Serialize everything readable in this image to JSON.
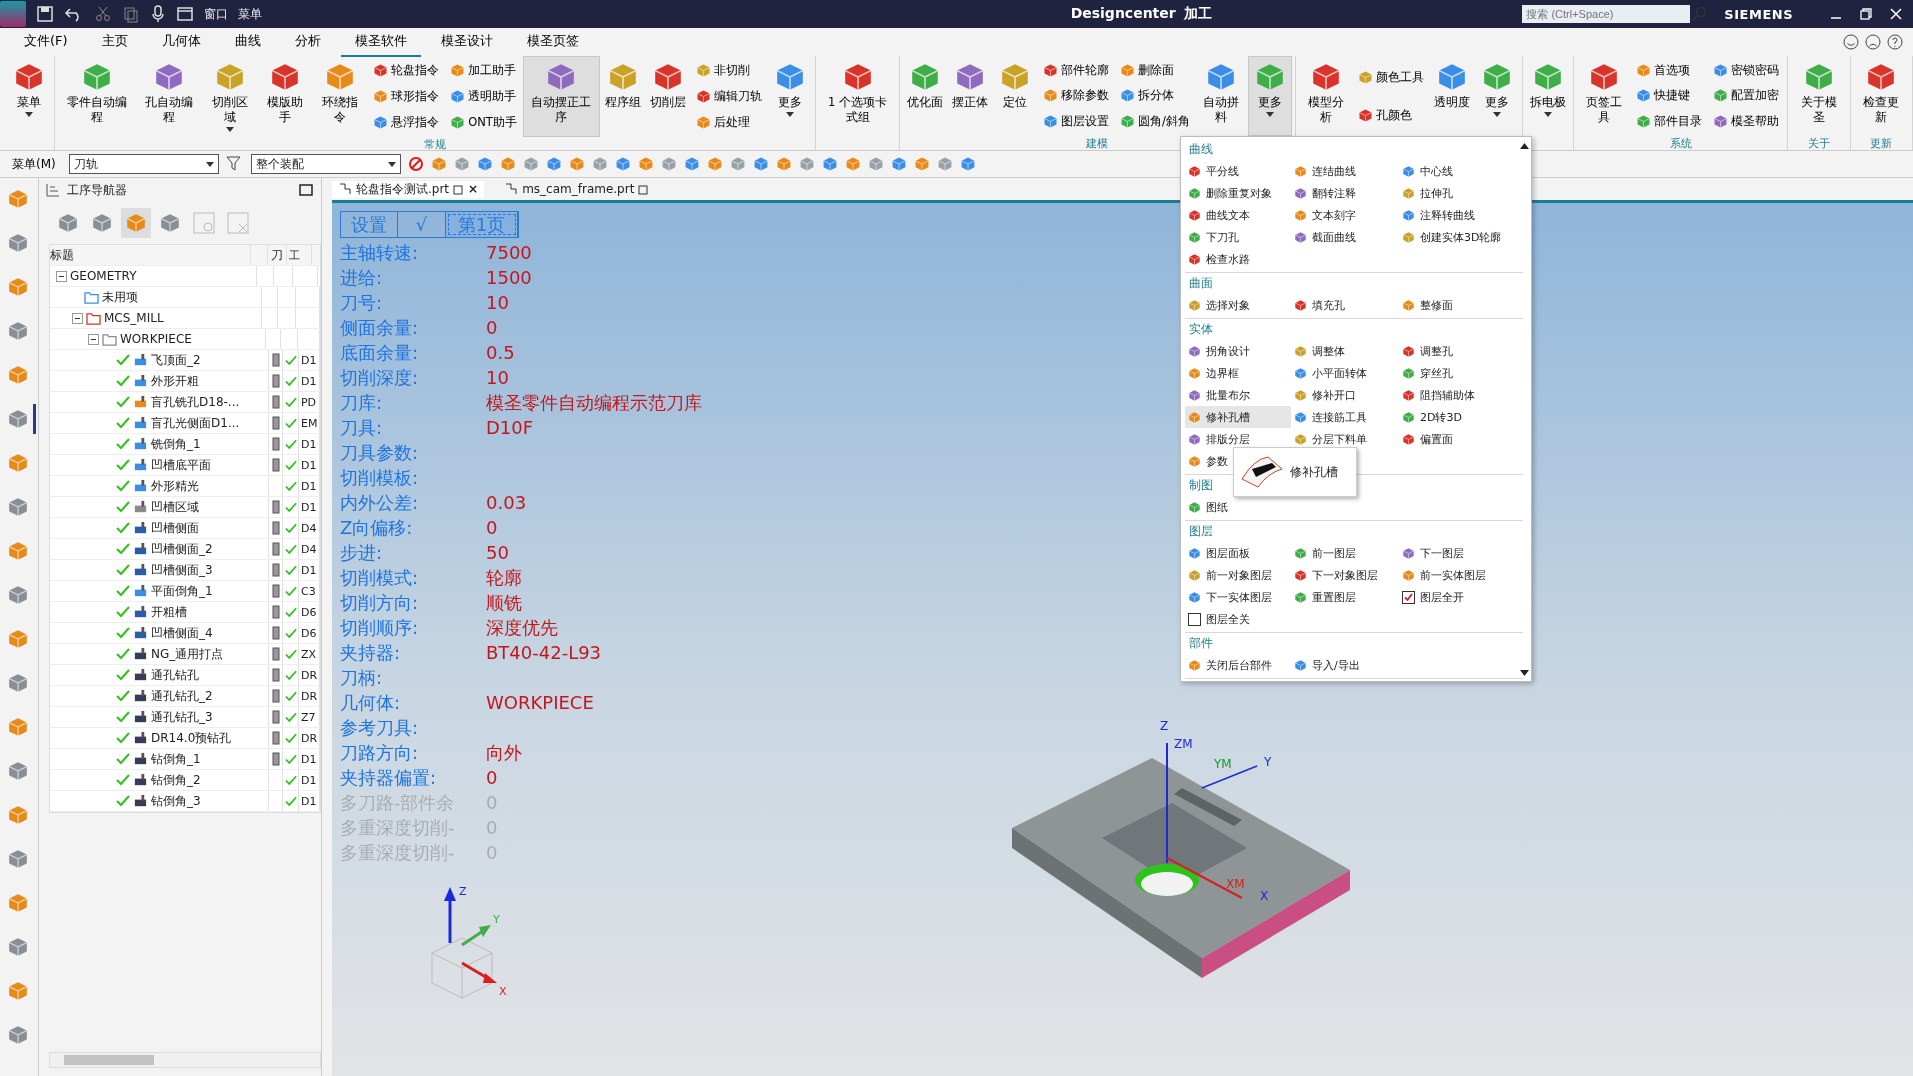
{
  "title_bar": {
    "quick_access": [
      "窗口",
      "菜单"
    ],
    "app_title": "Designcenter",
    "mode": "加工",
    "search_placeholder": "搜索 (Ctrl+Space)",
    "brand": "SIEMENS"
  },
  "menu_tabs": [
    {
      "label": "文件(F)",
      "selected": false
    },
    {
      "label": "主页",
      "selected": false
    },
    {
      "label": "几何体",
      "selected": false
    },
    {
      "label": "曲线",
      "selected": false
    },
    {
      "label": "分析",
      "selected": false
    },
    {
      "label": "模圣软件",
      "selected": true
    },
    {
      "label": "模圣设计",
      "selected": false
    },
    {
      "label": "模圣页签",
      "selected": false
    }
  ],
  "ribbon": [
    {
      "tools": [
        {
          "kind": "large",
          "label": "菜单",
          "pressed": false,
          "caret": true
        }
      ]
    },
    {
      "label": "常规",
      "tools": [
        {
          "kind": "large",
          "label": "零件自动编程",
          "pressed": false,
          "caret": false
        },
        {
          "kind": "large",
          "label": "孔自动编程",
          "pressed": false,
          "caret": false
        },
        {
          "kind": "large",
          "label": "切削区域",
          "pressed": false,
          "caret": true
        },
        {
          "kind": "large",
          "label": "模版助手",
          "pressed": false,
          "caret": false
        },
        {
          "kind": "large",
          "label": "环绕指令",
          "pressed": false,
          "caret": false
        },
        {
          "kind": "stack",
          "items": [
            "轮盘指令",
            "球形指令",
            "悬浮指令"
          ]
        },
        {
          "kind": "stack",
          "items": [
            "加工助手",
            "透明助手",
            "ONT助手"
          ]
        },
        {
          "kind": "large",
          "label": "自动摆正工序",
          "pressed": true,
          "caret": false
        },
        {
          "kind": "large",
          "label": "程序组",
          "pressed": false,
          "caret": false
        },
        {
          "kind": "large",
          "label": "切削层",
          "pressed": false,
          "caret": false
        },
        {
          "kind": "stack",
          "items": [
            "非切削",
            "编辑刀轨",
            "后处理"
          ]
        },
        {
          "kind": "large",
          "label": "更多",
          "pressed": false,
          "caret": true
        }
      ]
    },
    {
      "tools": [
        {
          "kind": "large",
          "label": "1 个选项卡式组",
          "pressed": false,
          "caret": false
        }
      ]
    },
    {
      "label": "建模",
      "tools": [
        {
          "kind": "large",
          "label": "优化面",
          "pressed": false,
          "caret": false
        },
        {
          "kind": "large",
          "label": "摆正体",
          "pressed": false,
          "caret": false
        },
        {
          "kind": "large",
          "label": "定位",
          "pressed": false,
          "caret": false
        },
        {
          "kind": "stack",
          "items": [
            "部件轮廓",
            "移除参数",
            "图层设置"
          ]
        },
        {
          "kind": "stack",
          "items": [
            "删除面",
            "拆分体",
            "圆角/斜角"
          ]
        },
        {
          "kind": "large",
          "label": "自动拼料",
          "pressed": false,
          "caret": false
        },
        {
          "kind": "large",
          "label": "更多",
          "pressed": true,
          "caret": true
        }
      ]
    },
    {
      "tools": [
        {
          "kind": "large",
          "label": "模型分析",
          "pressed": false,
          "caret": false
        },
        {
          "kind": "stack",
          "items": [
            "颜色工具",
            "孔颜色"
          ]
        },
        {
          "kind": "large",
          "label": "透明度",
          "pressed": false,
          "caret": false
        },
        {
          "kind": "large",
          "label": "更多",
          "pressed": false,
          "caret": true
        }
      ]
    },
    {
      "tools": [
        {
          "kind": "large",
          "label": "拆电极",
          "pressed": false,
          "caret": true
        }
      ]
    },
    {
      "label": "系统",
      "tools": [
        {
          "kind": "large",
          "label": "页签工具",
          "pressed": false,
          "caret": false
        },
        {
          "kind": "stack",
          "items": [
            "首选项",
            "快捷键",
            "部件目录"
          ]
        },
        {
          "kind": "stack",
          "items": [
            "密锁密码",
            "配置加密",
            "模圣帮助"
          ]
        }
      ]
    },
    {
      "label": "关于",
      "tools": [
        {
          "kind": "large",
          "label": "关于模圣",
          "pressed": false,
          "caret": false
        }
      ]
    },
    {
      "label": "更新",
      "tools": [
        {
          "kind": "large",
          "label": "检查更新",
          "pressed": false,
          "caret": false
        }
      ]
    }
  ],
  "toolbar": {
    "menu_button": "菜单(M)",
    "filter": "刀轨",
    "scope": "整个装配"
  },
  "resource_bar": [
    {
      "selected": false
    },
    {
      "selected": false
    },
    {
      "selected": false
    },
    {
      "selected": false
    },
    {
      "selected": false
    },
    {
      "selected": true
    },
    {
      "selected": false
    },
    {
      "selected": false
    },
    {
      "selected": false
    },
    {
      "selected": false
    },
    {
      "selected": false
    },
    {
      "selected": false
    },
    {
      "selected": false
    },
    {
      "selected": false
    },
    {
      "selected": false
    },
    {
      "selected": false
    },
    {
      "selected": false
    },
    {
      "selected": false
    },
    {
      "selected": false
    },
    {
      "selected": false
    }
  ],
  "navigator": {
    "title": "工序导航器",
    "columns": [
      "标题",
      "刀",
      "工"
    ],
    "tree": [
      {
        "label": "GEOMETRY",
        "expanded": true,
        "children": [
          {
            "label": "未用项",
            "kind": "folder"
          },
          {
            "label": "MCS_MILL",
            "kind": "mcs",
            "expanded": true,
            "children": [
              {
                "label": "WORKPIECE",
                "kind": "workpiece",
                "expanded": true,
                "children": [
                  {
                    "label": "飞顶面_2",
                    "kind": "mill",
                    "generated": true,
                    "done": true,
                    "tool": "D1"
                  },
                  {
                    "label": "外形开粗",
                    "kind": "mill",
                    "generated": true,
                    "done": true,
                    "tool": "D1"
                  },
                  {
                    "label": "盲孔铣孔D18-...",
                    "kind": "hole",
                    "generated": true,
                    "done": true,
                    "tool": "PD"
                  },
                  {
                    "label": "盲孔光侧面D1...",
                    "kind": "mill",
                    "generated": true,
                    "done": true,
                    "tool": "EM"
                  },
                  {
                    "label": "铣倒角_1",
                    "kind": "mill",
                    "generated": true,
                    "done": true,
                    "tool": "D1"
                  },
                  {
                    "label": "凹槽底平面",
                    "kind": "mill",
                    "generated": true,
                    "done": true,
                    "tool": "D1"
                  },
                  {
                    "label": "外形精光",
                    "kind": "mill",
                    "generated": false,
                    "done": true,
                    "tool": "D1"
                  },
                  {
                    "label": "凹槽区域",
                    "kind": "area",
                    "generated": true,
                    "done": true,
                    "tool": "D1"
                  },
                  {
                    "label": "凹槽侧面",
                    "kind": "wall",
                    "generated": true,
                    "done": true,
                    "tool": "D4"
                  },
                  {
                    "label": "凹槽侧面_2",
                    "kind": "wall",
                    "generated": true,
                    "done": true,
                    "tool": "D4"
                  },
                  {
                    "label": "凹槽侧面_3",
                    "kind": "wall",
                    "generated": true,
                    "done": true,
                    "tool": "D1"
                  },
                  {
                    "label": "平面倒角_1",
                    "kind": "mill",
                    "generated": true,
                    "done": true,
                    "tool": "C3"
                  },
                  {
                    "label": "开粗槽",
                    "kind": "wall",
                    "generated": true,
                    "done": true,
                    "tool": "D6"
                  },
                  {
                    "label": "凹槽侧面_4",
                    "kind": "wall",
                    "generated": true,
                    "done": true,
                    "tool": "D6"
                  },
                  {
                    "label": "NG_通用打点",
                    "kind": "drill",
                    "generated": true,
                    "done": true,
                    "tool": "ZX"
                  },
                  {
                    "label": "通孔钻孔",
                    "kind": "drill",
                    "generated": true,
                    "done": true,
                    "tool": "DR"
                  },
                  {
                    "label": "通孔钻孔_2",
                    "kind": "drill",
                    "generated": true,
                    "done": true,
                    "tool": "DR"
                  },
                  {
                    "label": "通孔钻孔_3",
                    "kind": "drill",
                    "generated": true,
                    "done": true,
                    "tool": "Z7"
                  },
                  {
                    "label": "DR14.0预钻孔",
                    "kind": "drill",
                    "generated": true,
                    "done": true,
                    "tool": "DR"
                  },
                  {
                    "label": "钻倒角_1",
                    "kind": "drill",
                    "generated": true,
                    "done": true,
                    "tool": "D1"
                  },
                  {
                    "label": "钻倒角_2",
                    "kind": "drill",
                    "generated": false,
                    "done": true,
                    "tool": "D1"
                  },
                  {
                    "label": "钻倒角_3",
                    "kind": "drill",
                    "generated": false,
                    "done": true,
                    "tool": "D1"
                  }
                ]
              }
            ]
          }
        ]
      }
    ]
  },
  "doc_tabs": [
    {
      "label": "轮盘指令测试.prt",
      "selected": true,
      "close": "×"
    },
    {
      "label": "ms_cam_frame.prt",
      "selected": false
    }
  ],
  "params": {
    "header": [
      {
        "label": "设置",
        "selected": false
      },
      {
        "label": "√",
        "selected": false
      },
      {
        "label": "第1页",
        "selected": true
      }
    ],
    "rows": [
      {
        "label": "主轴转速:",
        "value": "7500",
        "disabled": false
      },
      {
        "label": "进给:",
        "value": "1500",
        "disabled": false
      },
      {
        "label": "刀号:",
        "value": "10",
        "disabled": false
      },
      {
        "label": "侧面余量:",
        "value": "0",
        "disabled": false
      },
      {
        "label": "底面余量:",
        "value": "0.5",
        "disabled": false
      },
      {
        "label": "切削深度:",
        "value": "10",
        "disabled": false
      },
      {
        "label": "刀库:",
        "value": "模圣零件自动编程示范刀库",
        "disabled": false
      },
      {
        "label": "刀具:",
        "value": "D10F",
        "disabled": false
      },
      {
        "label": "刀具参数:",
        "disabled": false
      },
      {
        "label": "切削模板:",
        "disabled": false
      },
      {
        "label": "内外公差:",
        "value": "0.03",
        "disabled": false
      },
      {
        "label": "Z向偏移:",
        "value": "0",
        "disabled": false
      },
      {
        "label": "步进:",
        "value": "50",
        "disabled": false
      },
      {
        "label": "切削模式:",
        "value": "轮廓",
        "disabled": false
      },
      {
        "label": "切削方向:",
        "value": "顺铣",
        "disabled": false
      },
      {
        "label": "切削顺序:",
        "value": "深度优先",
        "disabled": false
      },
      {
        "label": "夹持器:",
        "value": "BT40-42-L93",
        "disabled": false
      },
      {
        "label": "刀柄:",
        "disabled": false
      },
      {
        "label": "几何体:",
        "value": "WORKPIECE",
        "disabled": false
      },
      {
        "label": "参考刀具:",
        "disabled": false
      },
      {
        "label": "刀路方向:",
        "value": "向外",
        "disabled": false
      },
      {
        "label": "夹持器偏置:",
        "value": "0",
        "disabled": false
      },
      {
        "label": "多刀路-部件余",
        "value": "0",
        "disabled": true
      },
      {
        "label": "多重深度切削-",
        "value": "0",
        "disabled": true
      },
      {
        "label": "多重深度切削-",
        "value": "0",
        "disabled": true
      }
    ]
  },
  "more_menu": {
    "sections": [
      {
        "title": "曲线",
        "items": [
          {
            "label": "平分线",
            "kind": "command",
            "highlighted": false
          },
          {
            "label": "连结曲线",
            "kind": "command",
            "highlighted": false
          },
          {
            "label": "中心线",
            "kind": "command",
            "highlighted": false
          },
          {
            "label": "删除重复对象",
            "kind": "command",
            "highlighted": false
          },
          {
            "label": "翻转注释",
            "kind": "command",
            "highlighted": false
          },
          {
            "label": "拉伸孔",
            "kind": "command",
            "highlighted": false
          },
          {
            "label": "曲线文本",
            "kind": "command",
            "highlighted": false
          },
          {
            "label": "文本刻字",
            "kind": "command",
            "highlighted": false
          },
          {
            "label": "注释转曲线",
            "kind": "command",
            "highlighted": false
          },
          {
            "label": "下刀孔",
            "kind": "command",
            "highlighted": false
          },
          {
            "label": "截面曲线",
            "kind": "command",
            "highlighted": false
          },
          {
            "label": "创建实体3D轮廓",
            "kind": "command",
            "highlighted": false
          },
          {
            "label": "检查水路",
            "kind": "command",
            "highlighted": false
          }
        ]
      },
      {
        "title": "曲面",
        "items": [
          {
            "label": "选择对象",
            "kind": "command",
            "highlighted": false
          },
          {
            "label": "填充孔",
            "kind": "command",
            "highlighted": false
          },
          {
            "label": "整修面",
            "kind": "command",
            "highlighted": false
          }
        ]
      },
      {
        "title": "实体",
        "items": [
          {
            "label": "拐角设计",
            "kind": "command",
            "highlighted": false
          },
          {
            "label": "调整体",
            "kind": "command",
            "highlighted": false
          },
          {
            "label": "调整孔",
            "kind": "command",
            "highlighted": false
          },
          {
            "label": "边界框",
            "kind": "command",
            "highlighted": false
          },
          {
            "label": "小平面转体",
            "kind": "command",
            "highlighted": false
          },
          {
            "label": "穿丝孔",
            "kind": "command",
            "highlighted": false
          },
          {
            "label": "批量布尔",
            "kind": "command",
            "highlighted": false
          },
          {
            "label": "修补开口",
            "kind": "command",
            "highlighted": false
          },
          {
            "label": "阻挡辅助体",
            "kind": "command",
            "highlighted": false
          },
          {
            "label": "修补孔槽",
            "kind": "command",
            "highlighted": true
          },
          {
            "label": "连接筋工具",
            "kind": "command",
            "highlighted": false
          },
          {
            "label": "2D转3D",
            "kind": "command",
            "highlighted": false
          },
          {
            "label": "排版分层",
            "kind": "command",
            "highlighted": false
          },
          {
            "label": "分层下料单",
            "kind": "command",
            "highlighted": false
          },
          {
            "label": "偏置面",
            "kind": "command",
            "highlighted": false
          },
          {
            "label": "参数",
            "kind": "command",
            "highlighted": false
          }
        ]
      },
      {
        "title": "制图",
        "items": [
          {
            "label": "图纸",
            "kind": "command",
            "highlighted": false
          }
        ]
      },
      {
        "title": "图层",
        "items": [
          {
            "label": "图层面板",
            "kind": "command",
            "highlighted": false
          },
          {
            "label": "前一图层",
            "kind": "command",
            "highlighted": false
          },
          {
            "label": "下一图层",
            "kind": "command",
            "highlighted": false
          },
          {
            "label": "前一对象图层",
            "kind": "command",
            "highlighted": false
          },
          {
            "label": "下一对象图层",
            "kind": "command",
            "highlighted": false
          },
          {
            "label": "前一实体图层",
            "kind": "command",
            "highlighted": false
          },
          {
            "label": "下一实体图层",
            "kind": "command",
            "highlighted": false
          },
          {
            "label": "重置图层",
            "kind": "command",
            "highlighted": false
          },
          {
            "label": "图层全开",
            "kind": "checkbox",
            "checked": true,
            "highlighted": false
          },
          {
            "label": "图层全关",
            "kind": "checkbox",
            "checked": false,
            "highlighted": false
          }
        ]
      },
      {
        "title": "部件",
        "items": [
          {
            "label": "关闭后台部件",
            "kind": "command",
            "highlighted": false
          },
          {
            "label": "导入/导出",
            "kind": "command",
            "highlighted": false
          }
        ]
      }
    ],
    "tooltip": "修补孔槽"
  },
  "viewport": {
    "part_axis_labels": [
      "Z",
      "ZM",
      "YM",
      "Y",
      "XM",
      "X"
    ],
    "triad_labels": [
      "Z",
      "Y",
      "X"
    ]
  }
}
